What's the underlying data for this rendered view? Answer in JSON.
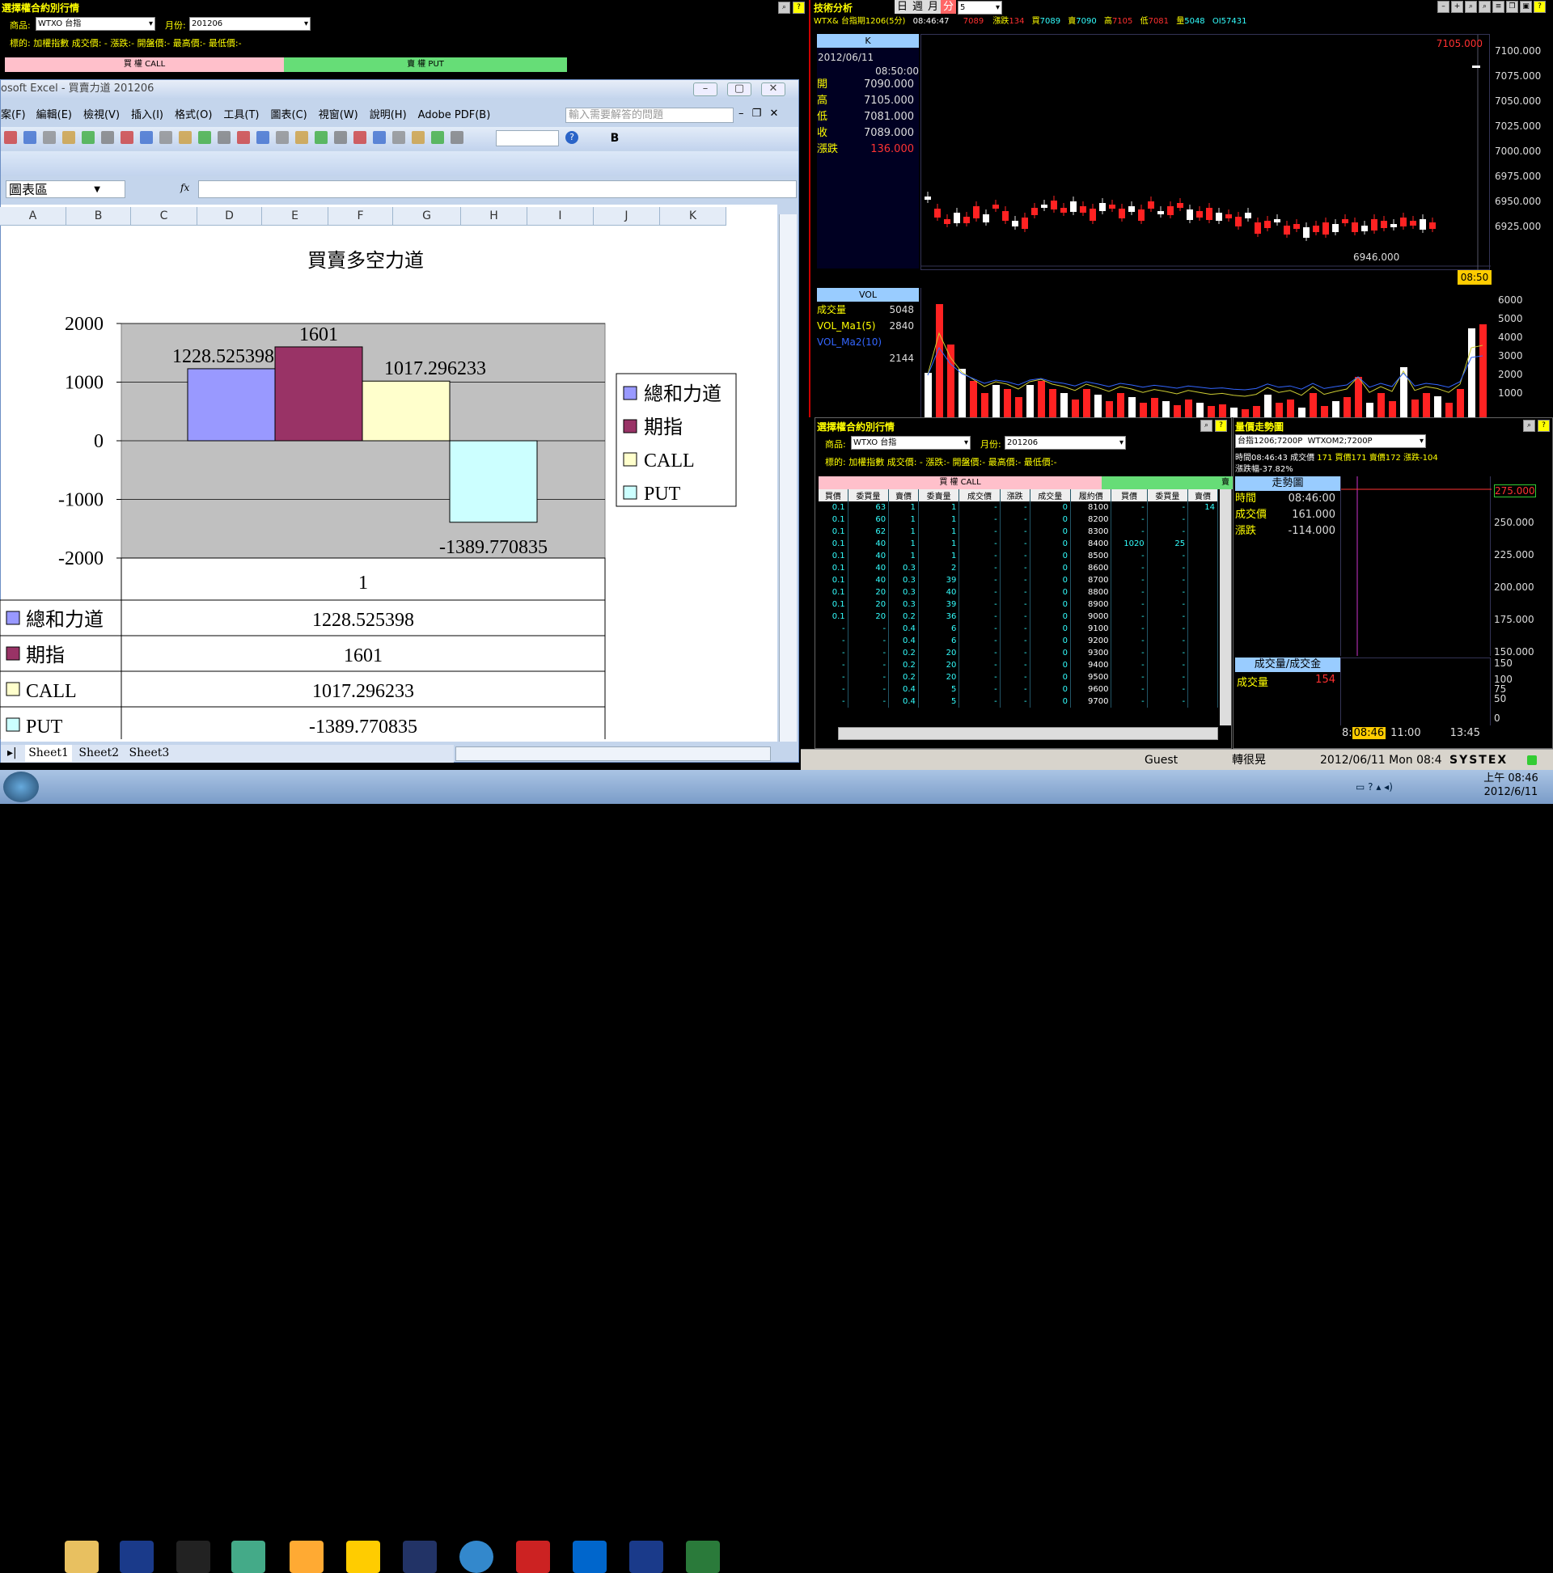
{
  "top_option_panel": {
    "title": "選擇權合約別行情",
    "product_label": "商品:",
    "product_value": "WTXO 台指",
    "month_label": "月份:",
    "month_value": "201206",
    "info": "標的: 加權指數  成交價:  -  漲跌:-  開盤價:-  最高價:-  最低價:-",
    "call_label": "買 權 CALL",
    "put_label": "賣 權 PUT"
  },
  "tech": {
    "title": "技術分析",
    "period_tabs": [
      "日",
      "週",
      "月",
      "分"
    ],
    "period_value": "5",
    "info": {
      "symbol": "WTX& 台指期1206(5分)",
      "time": "08:46:47",
      "last": "7089",
      "chg_label": "漲跌",
      "chg": "134",
      "bid_label": "買",
      "bid": "7089",
      "ask_label": "賣",
      "ask": "7090",
      "high_label": "高",
      "high": "7105",
      "low_label": "低",
      "low": "7081",
      "vol_label": "量",
      "vol": "5048",
      "oi": "OI57431"
    },
    "k_label": "K",
    "date": "2012/06/11",
    "kline_time": "08:50:00",
    "ohlc": [
      {
        "label": "開",
        "value": "7090.000"
      },
      {
        "label": "高",
        "value": "7105.000"
      },
      {
        "label": "低",
        "value": "7081.000"
      },
      {
        "label": "收",
        "value": "7089.000"
      },
      {
        "label": "漲跌",
        "value": "136.000"
      }
    ],
    "max_label": "7105.000",
    "min_label": "6946.000",
    "time_marker": "08:50",
    "price_axis": [
      "7100.000",
      "7075.000",
      "7050.000",
      "7025.000",
      "7000.000",
      "6975.000",
      "6950.000",
      "6925.000"
    ],
    "vol_title": "VOL",
    "vol_items": [
      {
        "label": "成交量",
        "value": "5048"
      },
      {
        "label": "VOL_Ma1(5)",
        "value": "2840"
      },
      {
        "label": "VOL_Ma2(10)",
        "value": ""
      },
      {
        "label": "",
        "value": "2144"
      }
    ],
    "vol_axis": [
      "6000",
      "5000",
      "4000",
      "3000",
      "2000",
      "1000"
    ]
  },
  "excel": {
    "title": "osoft Excel - 買賣力道 201206",
    "menu": [
      "案(F)",
      "編輯(E)",
      "檢視(V)",
      "插入(I)",
      "格式(O)",
      "工具(T)",
      "圖表(C)",
      "視窗(W)",
      "說明(H)",
      "Adobe PDF(B)"
    ],
    "help_placeholder": "輸入需要解答的問題",
    "namebox": "圖表區",
    "fx": "fx",
    "columns": [
      "A",
      "B",
      "C",
      "D",
      "E",
      "F",
      "G",
      "H",
      "I",
      "J",
      "K"
    ],
    "sheets": [
      "Sheet1",
      "Sheet2",
      "Sheet3"
    ]
  },
  "chart_data": {
    "type": "bar",
    "title": "買賣多空力道",
    "categories": [
      "1"
    ],
    "series": [
      {
        "name": "總和力道",
        "value": 1228.525398,
        "label": "1228.525398",
        "color": "#9999ff"
      },
      {
        "name": "期指",
        "value": 1601,
        "label": "1601",
        "color": "#993366"
      },
      {
        "name": "CALL",
        "value": 1017.296233,
        "label": "1017.296233",
        "color": "#ffffcc"
      },
      {
        "name": "PUT",
        "value": -1389.770835,
        "label": "-1389.770835",
        "color": "#ccffff"
      }
    ],
    "ylim": [
      -2000,
      2000
    ],
    "yticks": [
      "2000",
      "1000",
      "0",
      "-1000",
      "-2000"
    ],
    "legend": "right",
    "table_values": [
      "1228.525398",
      "1601",
      "1017.296233",
      "-1389.770835"
    ]
  },
  "bottom_option": {
    "title": "選擇權合約別行情",
    "product_label": "商品:",
    "product_value": "WTXO 台指",
    "month_label": "月份:",
    "month_value": "201206",
    "info": "標的: 加權指數  成交價:  -  漲跌:-  開盤價:-  最高價:-  最低價:-",
    "call_label": "買 權 CALL",
    "put_label": "賣",
    "headers": [
      "買價",
      "委買量",
      "賣價",
      "委賣量",
      "成交價",
      "漲跌",
      "成交量",
      "履約價",
      "買價",
      "委買量",
      "賣價"
    ],
    "rows": [
      [
        "0.1",
        "63",
        "1",
        "1",
        "-",
        "-",
        "0",
        "8100",
        "-",
        "-",
        "14"
      ],
      [
        "0.1",
        "60",
        "1",
        "1",
        "-",
        "-",
        "0",
        "8200",
        "-",
        "-",
        ""
      ],
      [
        "0.1",
        "62",
        "1",
        "1",
        "-",
        "-",
        "0",
        "8300",
        "-",
        "-",
        ""
      ],
      [
        "0.1",
        "40",
        "1",
        "1",
        "-",
        "-",
        "0",
        "8400",
        "1020",
        "25",
        ""
      ],
      [
        "0.1",
        "40",
        "1",
        "1",
        "-",
        "-",
        "0",
        "8500",
        "-",
        "-",
        ""
      ],
      [
        "0.1",
        "40",
        "0.3",
        "2",
        "-",
        "-",
        "0",
        "8600",
        "-",
        "-",
        ""
      ],
      [
        "0.1",
        "40",
        "0.3",
        "39",
        "-",
        "-",
        "0",
        "8700",
        "-",
        "-",
        ""
      ],
      [
        "0.1",
        "20",
        "0.3",
        "40",
        "-",
        "-",
        "0",
        "8800",
        "-",
        "-",
        ""
      ],
      [
        "0.1",
        "20",
        "0.3",
        "39",
        "-",
        "-",
        "0",
        "8900",
        "-",
        "-",
        ""
      ],
      [
        "0.1",
        "20",
        "0.2",
        "36",
        "-",
        "-",
        "0",
        "9000",
        "-",
        "-",
        ""
      ],
      [
        "-",
        "-",
        "0.4",
        "6",
        "-",
        "-",
        "0",
        "9100",
        "-",
        "-",
        ""
      ],
      [
        "-",
        "-",
        "0.4",
        "6",
        "-",
        "-",
        "0",
        "9200",
        "-",
        "-",
        ""
      ],
      [
        "-",
        "-",
        "0.2",
        "20",
        "-",
        "-",
        "0",
        "9300",
        "-",
        "-",
        ""
      ],
      [
        "-",
        "-",
        "0.2",
        "20",
        "-",
        "-",
        "0",
        "9400",
        "-",
        "-",
        ""
      ],
      [
        "-",
        "-",
        "0.2",
        "20",
        "-",
        "-",
        "0",
        "9500",
        "-",
        "-",
        ""
      ],
      [
        "-",
        "-",
        "0.4",
        "5",
        "-",
        "-",
        "0",
        "9600",
        "-",
        "-",
        ""
      ],
      [
        "-",
        "-",
        "0.4",
        "5",
        "-",
        "-",
        "0",
        "9700",
        "-",
        "-",
        ""
      ]
    ]
  },
  "trend": {
    "title": "量價走勢圖",
    "symbol1": "台指1206;7200P",
    "symbol2": "WTXOM2;7200P",
    "info1": "時間08:46:43 成交價",
    "info1b": "171 買價171 賣價172 漲跌-104",
    "info2": "漲跌幅-37.82%",
    "panel_title": "走勢圖",
    "items": [
      {
        "label": "時間",
        "value": "08:46:00"
      },
      {
        "label": "成交價",
        "value": "161.000"
      },
      {
        "label": "漲跌",
        "value": "-114.000"
      }
    ],
    "axis": [
      "275.000",
      "250.000",
      "225.000",
      "200.000",
      "175.000",
      "150.000"
    ],
    "vol_title": "成交量/成交金",
    "vol_label": "成交量",
    "vol_value": "154",
    "vol_axis": [
      "150",
      "100",
      "75",
      "50",
      "0"
    ],
    "time_axis": [
      "8:",
      "08:46",
      "11:00",
      "13:45"
    ]
  },
  "status": {
    "user": "Guest",
    "quote": "轉很晃",
    "datetime": "2012/06/11 Mon 08:4",
    "brand": "SYSTEX"
  },
  "taskbar": {
    "clock_time": "上午 08:46",
    "clock_date": "2012/6/11"
  }
}
